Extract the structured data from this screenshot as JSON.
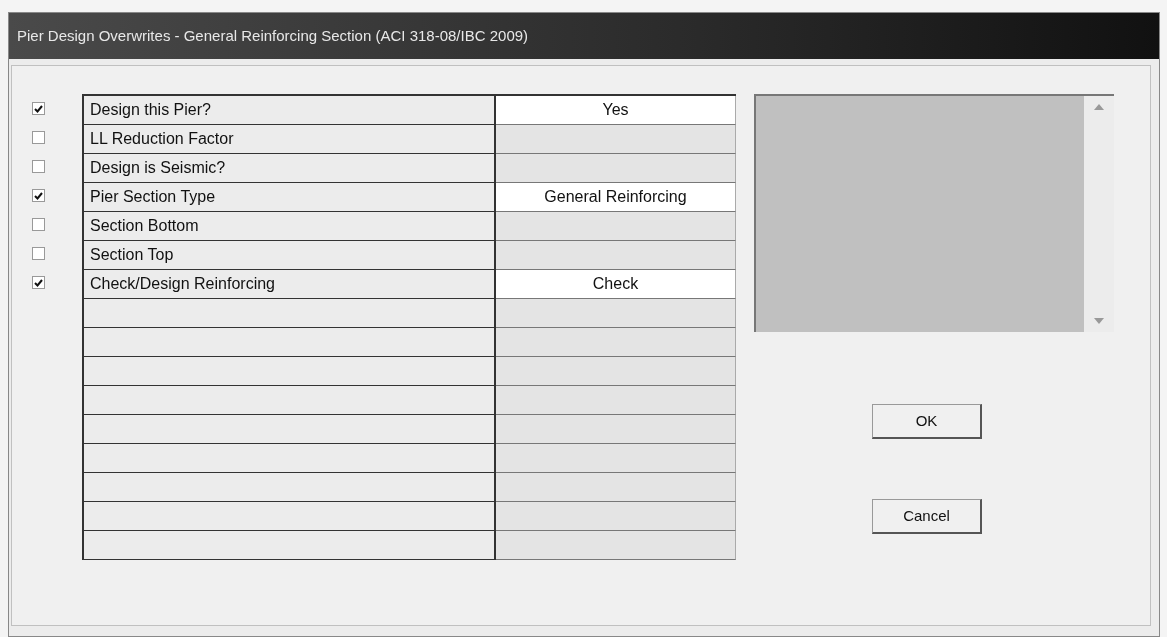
{
  "window": {
    "title": "Pier Design Overwrites - General Reinforcing Section (ACI 318-08/IBC 2009)"
  },
  "items": [
    {
      "label": "Design this Pier?",
      "checked": true,
      "value": "Yes"
    },
    {
      "label": "LL Reduction Factor",
      "checked": false
    },
    {
      "label": "Design is Seismic?",
      "checked": false
    },
    {
      "label": "Pier Section Type",
      "checked": true,
      "value": "General Reinforcing"
    },
    {
      "label": "Section Bottom",
      "checked": false
    },
    {
      "label": "Section Top",
      "checked": false
    },
    {
      "label": "Check/Design Reinforcing",
      "checked": true,
      "value": "Check"
    }
  ],
  "buttons": [
    "OK",
    "Cancel"
  ]
}
